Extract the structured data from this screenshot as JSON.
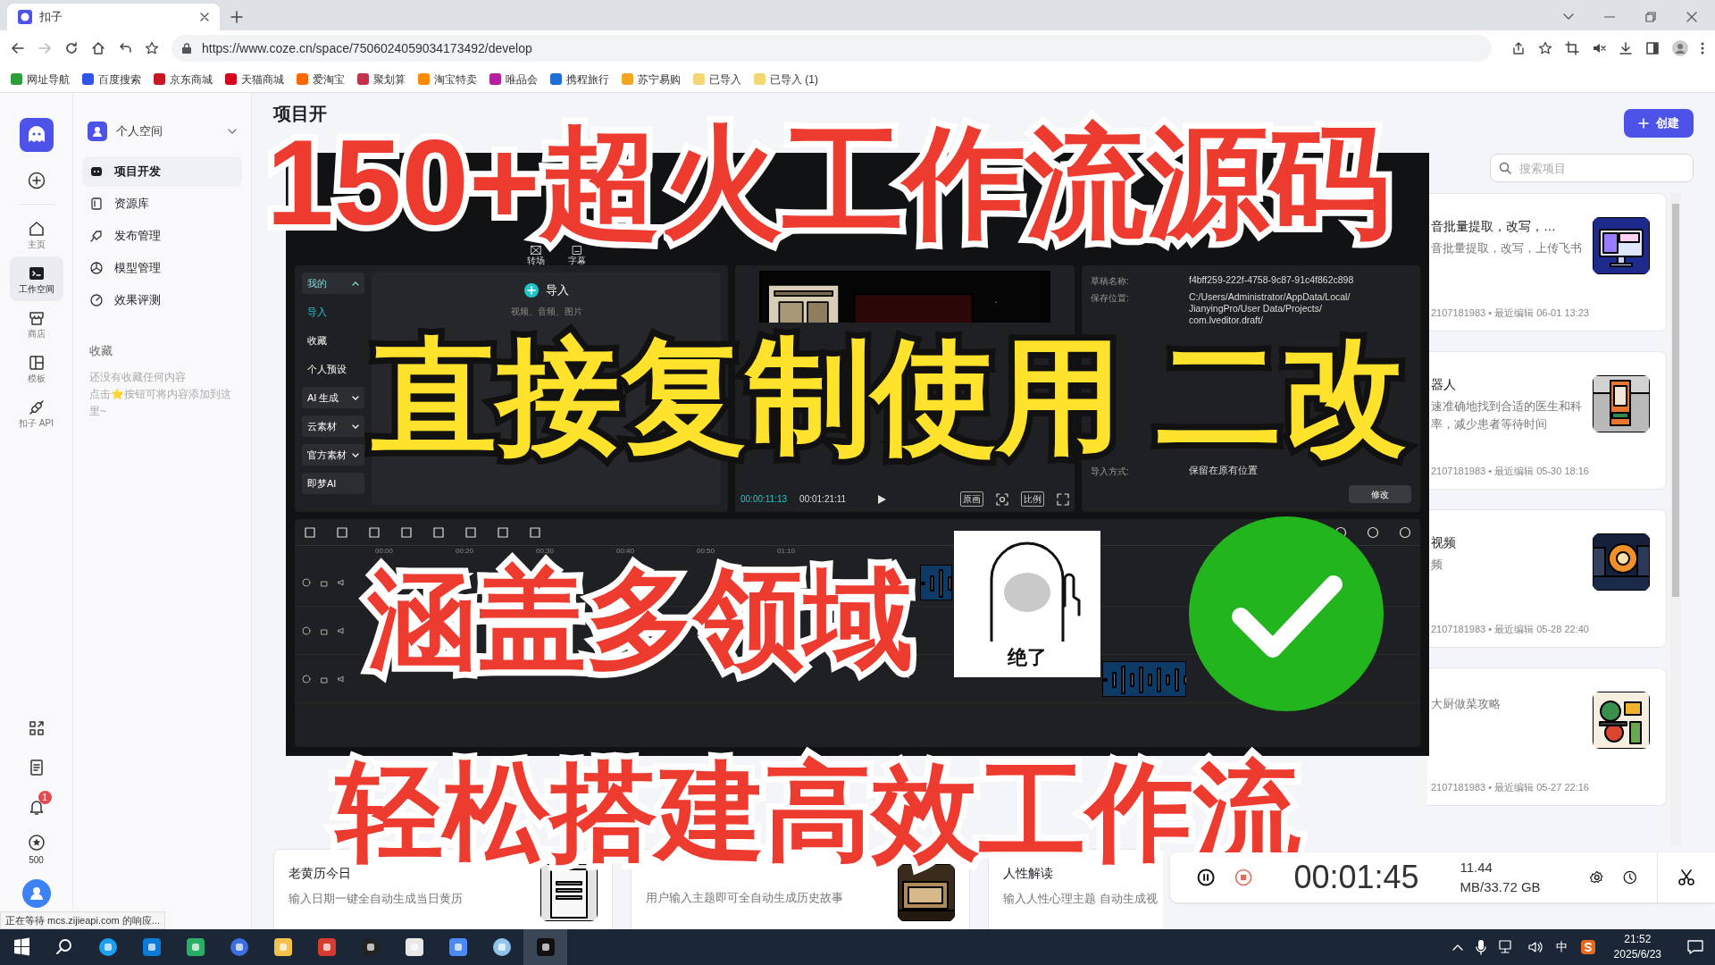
{
  "browser": {
    "tab_title": "扣子",
    "url": "https://www.coze.cn/space/7506024059034173492/develop",
    "bookmarks": [
      {
        "label": "网址导航",
        "color": "#2e9e3a"
      },
      {
        "label": "百度搜索",
        "color": "#2f54eb"
      },
      {
        "label": "京东商城",
        "color": "#c81623"
      },
      {
        "label": "天猫商城",
        "color": "#d6001c"
      },
      {
        "label": "爱淘宝",
        "color": "#ff6a00"
      },
      {
        "label": "聚划算",
        "color": "#c4314b"
      },
      {
        "label": "淘宝特卖",
        "color": "#ff8a00"
      },
      {
        "label": "唯品会",
        "color": "#b620a0"
      },
      {
        "label": "携程旅行",
        "color": "#1f6fd6"
      },
      {
        "label": "苏宁易购",
        "color": "#f5a623"
      },
      {
        "label": "已导入",
        "color": "#f4d774"
      },
      {
        "label": "已导入 (1)",
        "color": "#f4d774"
      }
    ]
  },
  "rail": {
    "items": [
      {
        "label": "主页",
        "selected": false
      },
      {
        "label": "工作空间",
        "selected": true
      },
      {
        "label": "商店",
        "selected": false
      },
      {
        "label": "模板",
        "selected": false
      },
      {
        "label": "扣子 API",
        "selected": false
      }
    ],
    "notification_count": "1",
    "points": "500"
  },
  "sidebar": {
    "space": "个人空间",
    "nav": [
      {
        "label": "项目开发",
        "selected": true
      },
      {
        "label": "资源库",
        "selected": false
      },
      {
        "label": "发布管理",
        "selected": false
      },
      {
        "label": "模型管理",
        "selected": false
      },
      {
        "label": "效果评测",
        "selected": false
      }
    ],
    "favorites_title": "收藏",
    "favorites_empty": [
      "还没有收藏任何内容",
      "点击⭐按钮可将内容添加到这里~"
    ]
  },
  "main": {
    "title": "项目开",
    "create_button": "创建",
    "search_placeholder": "搜索项目",
    "cards": [
      {
        "title": "音批量提取，改写，…",
        "desc": [
          "音批量提取，改写，上传飞书"
        ],
        "meta": "2107181983 • 最近编辑 06-01 13:23"
      },
      {
        "title": "器人",
        "desc": [
          "速准确地找到合适的医生和科",
          "率，减少患者等待时间"
        ],
        "meta": "2107181983 • 最近编辑 05-30 18:16"
      },
      {
        "title": "视频",
        "desc": [
          "频"
        ],
        "meta": "2107181983 • 最近编辑 05-28 22:40"
      },
      {
        "desc": [
          "大厨做菜攻略"
        ],
        "meta": "2107181983 • 最近编辑 05-27 22:16"
      }
    ],
    "bottom_cards": [
      {
        "title": "老黄历今日",
        "desc": "输入日期一键全自动生成当日黄历"
      },
      {
        "desc": "用户输入主题即可全自动生成历史故事"
      },
      {
        "title": "人性解读",
        "desc": "输入人性心理主题 自动生成视"
      }
    ]
  },
  "editor": {
    "tools": [
      "转场",
      "字幕"
    ],
    "media_nav": [
      {
        "label": "我的",
        "kind": "header",
        "selected": false
      },
      {
        "label": "导入",
        "kind": "item",
        "selected": true
      },
      {
        "label": "收藏",
        "kind": "item",
        "selected": false
      },
      {
        "label": "个人预设",
        "kind": "item",
        "selected": false
      },
      {
        "label": "AI 生成",
        "kind": "group",
        "selected": false
      },
      {
        "label": "云素材",
        "kind": "group",
        "selected": false
      },
      {
        "label": "官方素材",
        "kind": "group",
        "selected": false
      },
      {
        "label": "即梦AI",
        "kind": "tile",
        "selected": false
      }
    ],
    "import_button": "导入",
    "import_hint": "视频、音频、图片",
    "current_time": "00:00:11:13",
    "total_time": "00:01:21:11",
    "preview_buttons": [
      "原画",
      "比例"
    ],
    "properties": [
      {
        "label": "草稿名称:",
        "value": [
          "f4bff259-222f-4758-9c87-91c4f862c898"
        ]
      },
      {
        "label": "保存位置:",
        "value": [
          "C:/Users/Administrator/AppData/Local/",
          "JianyingPro/User Data/Projects/",
          "com.lveditor.draft/"
        ]
      },
      {
        "label": "导入方式:",
        "value": [
          "保留在原有位置"
        ]
      }
    ],
    "modify_button": "修改",
    "ticks": [
      "00:00",
      "00:20",
      "00:30",
      "00:40",
      "00:50",
      "01:10"
    ]
  },
  "captions": [
    {
      "text": "150+超火工作流源码",
      "kind": "headline"
    },
    {
      "text": "直接复制使用 二改",
      "kind": "callout"
    },
    {
      "text": "涵盖多领域",
      "kind": "headline"
    },
    {
      "text": "轻松搭建高效工作流",
      "kind": "headline"
    }
  ],
  "meme_caption": "绝了",
  "recorder": {
    "time": "00:01:45",
    "storage": "11.44 MB/33.72 GB"
  },
  "status_text": "正在等待 mcs.zijieapi.com 的响应...",
  "taskbar": {
    "ime": "中",
    "time": "21:52",
    "date": "2025/6/23"
  }
}
